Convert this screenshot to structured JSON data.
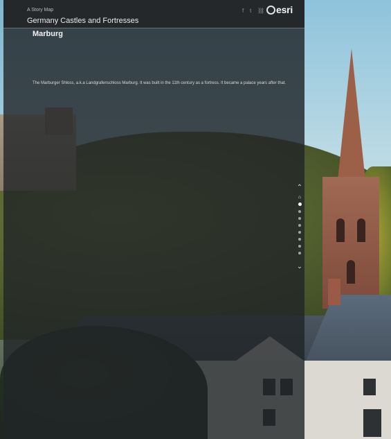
{
  "story": {
    "eyebrow": "A Story Map",
    "title": "Germany Castles and Fortresses"
  },
  "header": {
    "share_icons": [
      "facebook-icon",
      "twitter-icon",
      "link-icon"
    ],
    "logo_text": "esri"
  },
  "section": {
    "title": "Marburg",
    "text": "The Marburger Shloss, a.k.a Landgrafenschloss Marburg. It was built in the 11th century as a fortress. It became a palace years after that."
  },
  "navigation": {
    "up_glyph": "⌃",
    "down_glyph": "⌄",
    "home_glyph": "⌂",
    "dot_count": 8,
    "active_index": 1
  },
  "colors": {
    "panel_overlay": "#212427",
    "header_bg": "#25282b",
    "text_light": "#e9eaeb"
  }
}
